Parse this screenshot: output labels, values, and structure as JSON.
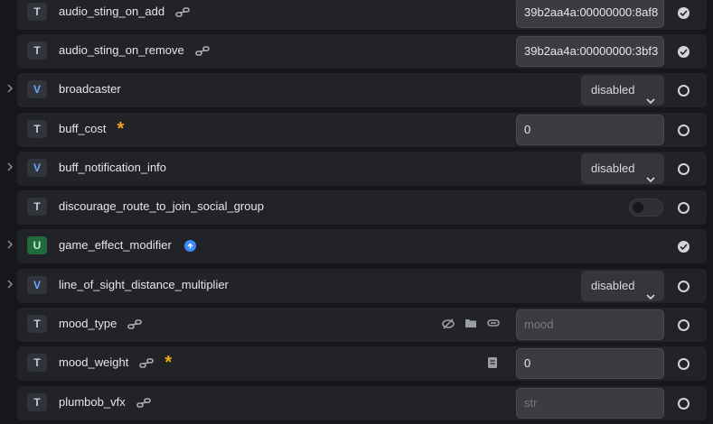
{
  "rows": [
    {
      "type": "T",
      "name": "audio_sting_on_add",
      "linked": true,
      "control": "input",
      "value": "39b2aa4a:00000000:8af8",
      "status": "checked"
    },
    {
      "type": "T",
      "name": "audio_sting_on_remove",
      "linked": true,
      "control": "input",
      "value": "39b2aa4a:00000000:3bf3",
      "status": "checked"
    },
    {
      "type": "V",
      "name": "broadcaster",
      "expandable": true,
      "control": "select",
      "value": "disabled",
      "status": "empty"
    },
    {
      "type": "T",
      "name": "buff_cost",
      "required": true,
      "control": "input",
      "value": "0",
      "status": "empty"
    },
    {
      "type": "V",
      "name": "buff_notification_info",
      "expandable": true,
      "control": "select",
      "value": "disabled",
      "status": "empty"
    },
    {
      "type": "T",
      "name": "discourage_route_to_join_social_group",
      "control": "toggle",
      "value": "off",
      "status": "empty"
    },
    {
      "type": "U",
      "name": "game_effect_modifier",
      "expandable": true,
      "info": true,
      "control": "none",
      "status": "checked"
    },
    {
      "type": "V",
      "name": "line_of_sight_distance_multiplier",
      "expandable": true,
      "control": "select",
      "value": "disabled",
      "status": "empty"
    },
    {
      "type": "T",
      "name": "mood_type",
      "linked": true,
      "tools": [
        "hide-icon",
        "folder-icon",
        "link-icon"
      ],
      "control": "input",
      "placeholder": "mood",
      "status": "empty"
    },
    {
      "type": "T",
      "name": "mood_weight",
      "linked": true,
      "required": true,
      "tools": [
        "document-icon"
      ],
      "control": "input",
      "value": "0",
      "status": "empty"
    },
    {
      "type": "T",
      "name": "plumbob_vfx",
      "linked": true,
      "control": "input",
      "placeholder": "str",
      "status": "empty"
    }
  ],
  "colors": {
    "background": "#16171a",
    "row": "#222327",
    "required": "#f4a71c",
    "info": "#3d8bff",
    "u_badge": "#1f6b3c"
  },
  "icons": {
    "expand": "chevron-right-icon",
    "linked": "link-chain-icon",
    "required": "asterisk-icon",
    "info": "arrow-up-circle-icon",
    "select": "chevron-down-icon"
  },
  "star_glyph": "*"
}
